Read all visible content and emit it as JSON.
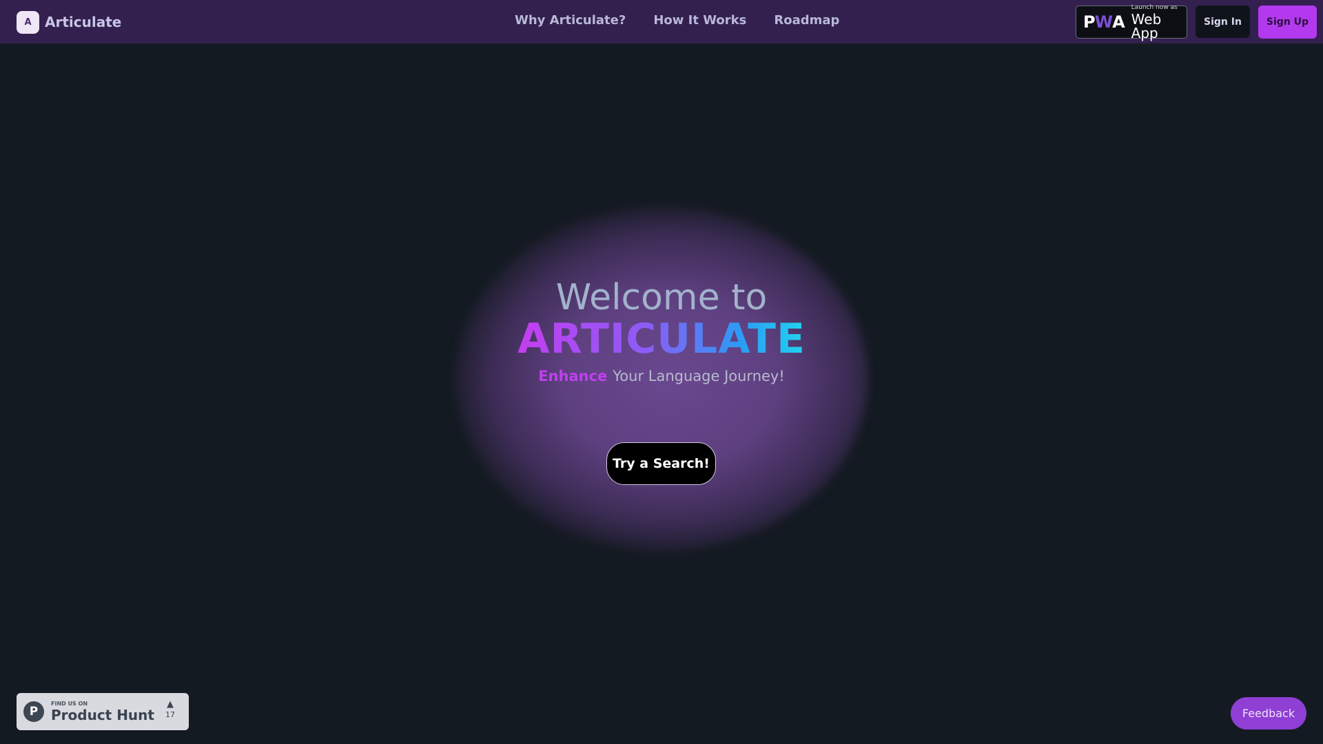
{
  "header": {
    "brand_logo_text": "A",
    "brand_name": "Articulate",
    "nav": [
      "Why Articulate?",
      "How It Works",
      "Roadmap"
    ],
    "pwa": {
      "small": "Launch now as",
      "big": "Web App",
      "logo_p": "P",
      "logo_w": "W",
      "logo_a": "A"
    },
    "signin_label": "Sign In",
    "signup_label": "Sign Up"
  },
  "hero": {
    "welcome": "Welcome to",
    "title": "ARTICULATE",
    "sub_accent": "Enhance",
    "sub_rest": "Your Language Journey!",
    "cta_label": "Try a Search!"
  },
  "product_hunt": {
    "small": "FIND US ON",
    "big": "Product Hunt",
    "logo": "P",
    "arrow": "▲",
    "count": "17"
  },
  "feedback_label": "Feedback",
  "colors": {
    "navbar": "#33204f",
    "background": "#141a22",
    "accent": "#b339ee",
    "feedback": "#8f3fd4"
  }
}
